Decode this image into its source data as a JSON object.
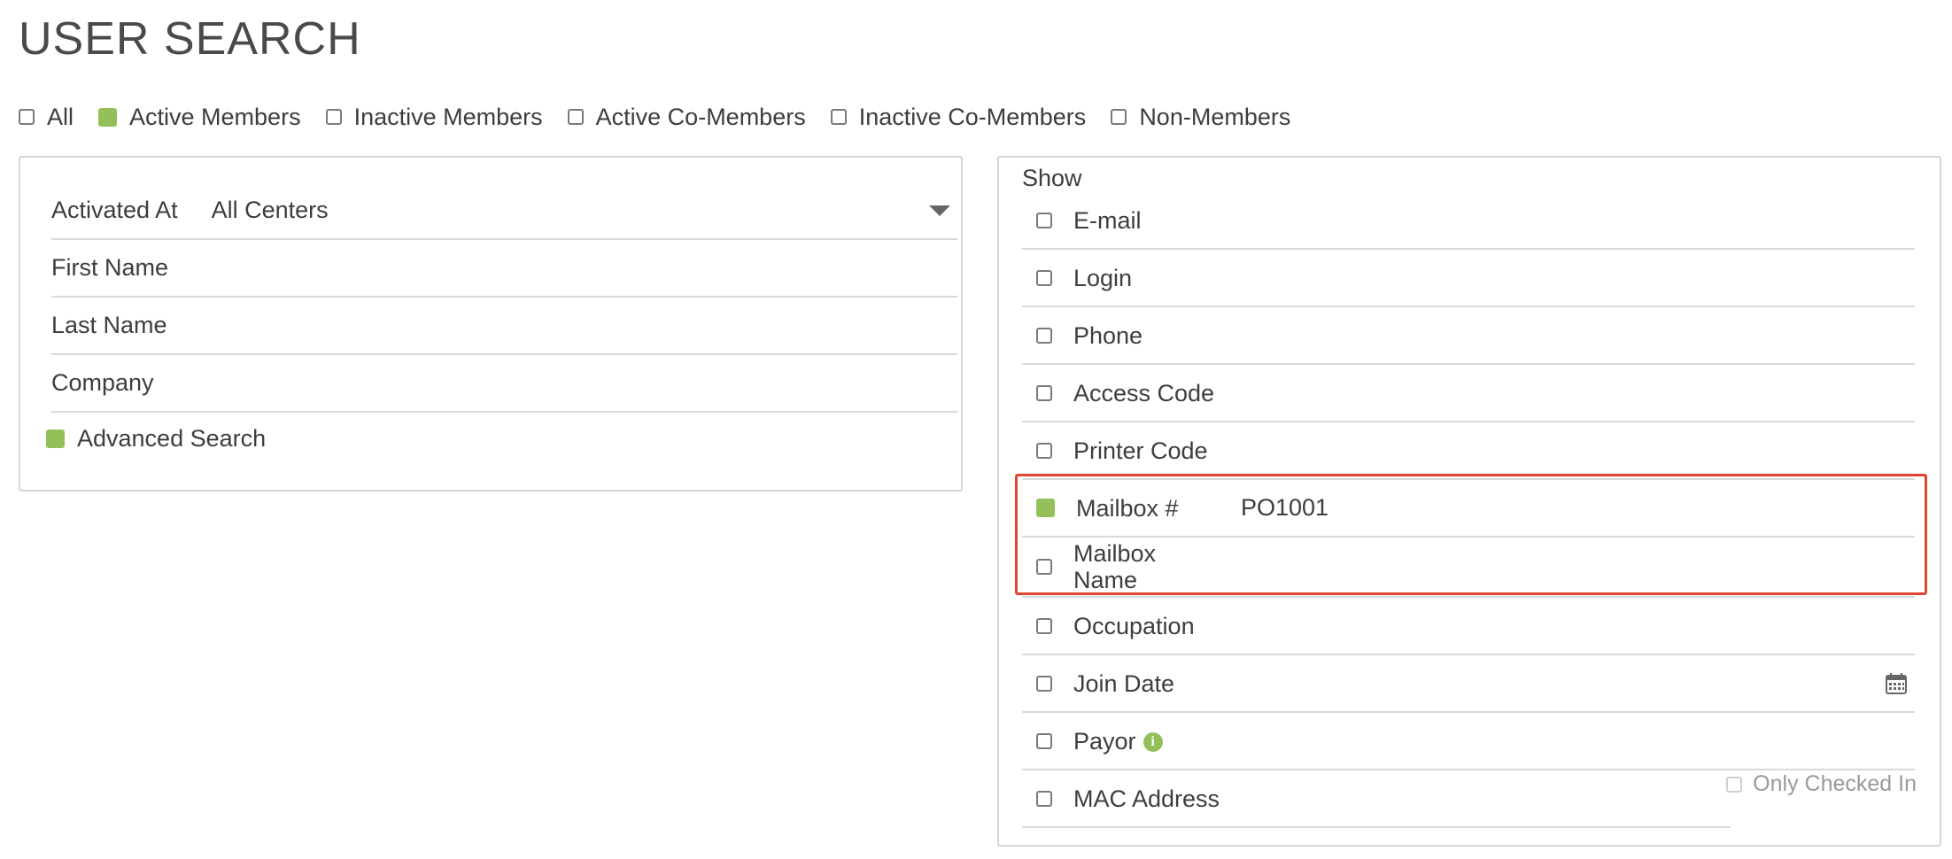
{
  "page": {
    "title": "USER SEARCH"
  },
  "filters": [
    {
      "label": "All",
      "checked": false
    },
    {
      "label": "Active Members",
      "checked": true
    },
    {
      "label": "Inactive Members",
      "checked": false
    },
    {
      "label": "Active Co-Members",
      "checked": false
    },
    {
      "label": "Inactive Co-Members",
      "checked": false
    },
    {
      "label": "Non-Members",
      "checked": false
    }
  ],
  "search_form": {
    "activated_at_label": "Activated At",
    "activated_at_value": "All Centers",
    "first_name_label": "First Name",
    "last_name_label": "Last Name",
    "company_label": "Company",
    "advanced_search_label": "Advanced Search",
    "advanced_search_checked": true
  },
  "show_panel": {
    "label": "Show",
    "options": [
      {
        "label": "E-mail",
        "checked": false,
        "value": ""
      },
      {
        "label": "Login",
        "checked": false,
        "value": ""
      },
      {
        "label": "Phone",
        "checked": false,
        "value": ""
      },
      {
        "label": "Access Code",
        "checked": false,
        "value": ""
      },
      {
        "label": "Printer Code",
        "checked": false,
        "value": ""
      },
      {
        "label": "Mailbox #",
        "checked": true,
        "value": "PO1001"
      },
      {
        "label": "Mailbox Name",
        "checked": false,
        "value": ""
      },
      {
        "label": "Occupation",
        "checked": false,
        "value": ""
      },
      {
        "label": "Join Date",
        "checked": false,
        "value": "",
        "icon": "calendar-icon"
      },
      {
        "label": "Payor",
        "checked": false,
        "value": "",
        "icon": "info-icon"
      },
      {
        "label": "MAC Address",
        "checked": false,
        "value": ""
      }
    ],
    "only_checked_in_label": "Only Checked In",
    "only_checked_in_checked": false
  },
  "colors": {
    "accent": "#94c05a",
    "highlight": "#e0452f",
    "border": "#d6d6d6"
  }
}
